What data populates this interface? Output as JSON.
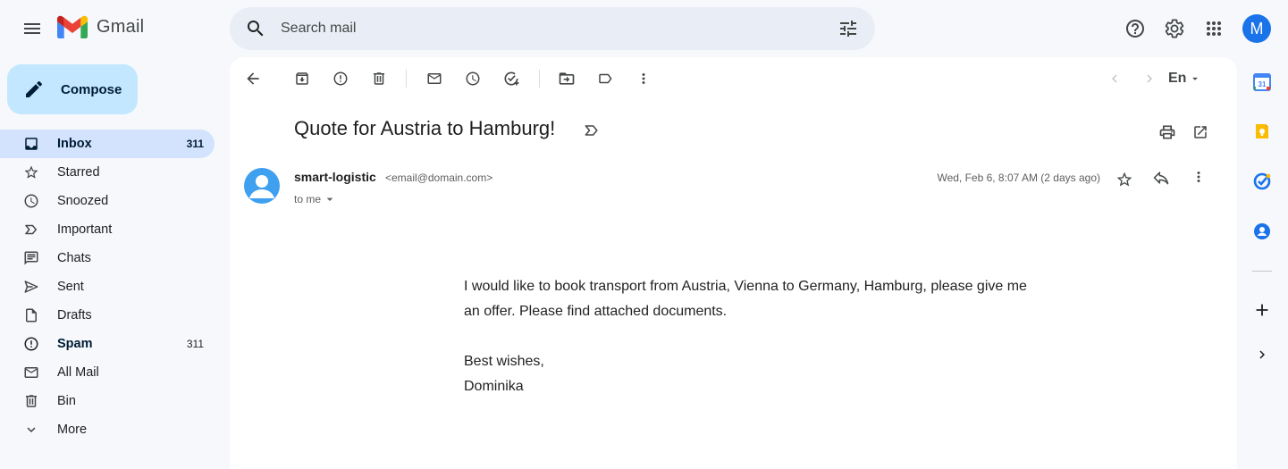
{
  "app": {
    "name": "Gmail"
  },
  "search": {
    "placeholder": "Search mail",
    "value": ""
  },
  "account": {
    "initial": "M",
    "color": "#1a73e8"
  },
  "sidebar": {
    "compose_label": "Compose",
    "items": [
      {
        "label": "Inbox",
        "count": "311",
        "icon": "inbox-icon",
        "active": true,
        "bold": true
      },
      {
        "label": "Starred",
        "count": "",
        "icon": "star-icon"
      },
      {
        "label": "Snoozed",
        "count": "",
        "icon": "clock-icon"
      },
      {
        "label": "Important",
        "count": "",
        "icon": "important-icon"
      },
      {
        "label": "Chats",
        "count": "",
        "icon": "chat-icon"
      },
      {
        "label": "Sent",
        "count": "",
        "icon": "send-icon"
      },
      {
        "label": "Drafts",
        "count": "",
        "icon": "draft-icon"
      },
      {
        "label": "Spam",
        "count": "311",
        "icon": "spam-icon",
        "bold": true
      },
      {
        "label": "All Mail",
        "count": "",
        "icon": "mail-icon"
      },
      {
        "label": "Bin",
        "count": "",
        "icon": "trash-icon"
      },
      {
        "label": "More",
        "count": "",
        "icon": "chevron-down-icon"
      }
    ]
  },
  "toolbar": {
    "input_tools_label": "En"
  },
  "email": {
    "subject": "Quote for Austria to Hamburg!",
    "sender_name": "smart-logistic",
    "sender_email": "<email@domain.com>",
    "recipient_label": "to me",
    "date": "Wed, Feb 6, 8:07 AM (2 days ago)",
    "body": [
      "I would like to book transport from Austria, Vienna to Germany, Hamburg, please give me an offer.  Please find attached documents.",
      "Best wishes,",
      "Dominika"
    ]
  },
  "colors": {
    "background": "#f6f8fc",
    "compose": "#c2e7ff",
    "active_nav": "#d3e3fd",
    "search": "#e9eef6",
    "sender_avatar": "#3fa0f0"
  }
}
